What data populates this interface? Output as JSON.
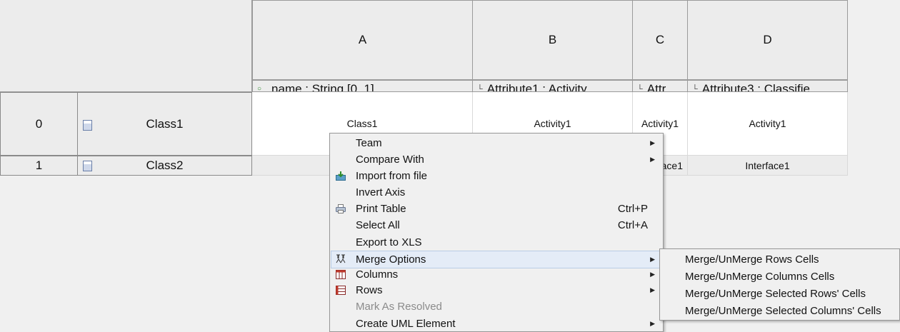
{
  "table": {
    "columns": [
      {
        "letter": "A",
        "sub": "name : String [0..1]",
        "marker": "dot"
      },
      {
        "letter": "B",
        "sub": "Attribute1 : Activity",
        "marker": "corner"
      },
      {
        "letter": "C",
        "sub": "Attr",
        "marker": "corner"
      },
      {
        "letter": "D",
        "sub": "Attribute3 : Classifie",
        "marker": "corner"
      }
    ],
    "rows": [
      {
        "index": "0",
        "name": "Class1",
        "cells": [
          "Class1",
          "Activity1",
          "Activity1",
          "Activity1"
        ]
      },
      {
        "index": "1",
        "name": "Class2",
        "cells": [
          "",
          "",
          "ace1",
          "Interface1"
        ]
      }
    ]
  },
  "context_menu": {
    "items": [
      {
        "label": "Team",
        "submenu": true
      },
      {
        "label": "Compare With",
        "submenu": true
      },
      {
        "label": "Import from file",
        "icon": "import-icon"
      },
      {
        "label": "Invert Axis"
      },
      {
        "label": "Print Table",
        "shortcut": "Ctrl+P",
        "icon": "printer-icon"
      },
      {
        "label": "Select All",
        "shortcut": "Ctrl+A"
      },
      {
        "label": "Export to XLS"
      },
      {
        "label": "Merge Options",
        "submenu": true,
        "icon": "merge-icon",
        "highlighted": true
      },
      {
        "label": "Columns",
        "submenu": true,
        "icon": "columns-icon"
      },
      {
        "label": "Rows",
        "submenu": true,
        "icon": "rows-icon"
      },
      {
        "label": "Mark As Resolved",
        "disabled": true
      },
      {
        "label": "Create UML Element",
        "submenu": true
      }
    ]
  },
  "merge_submenu": {
    "items": [
      "Merge/UnMerge Rows Cells",
      "Merge/UnMerge Columns Cells",
      "Merge/UnMerge Selected Rows' Cells",
      "Merge/UnMerge Selected Columns' Cells"
    ]
  },
  "colors": {
    "highlight_bg": "#e4ecf7",
    "menu_bg": "#f0f0f0",
    "cell_bg": "#ffffff"
  }
}
